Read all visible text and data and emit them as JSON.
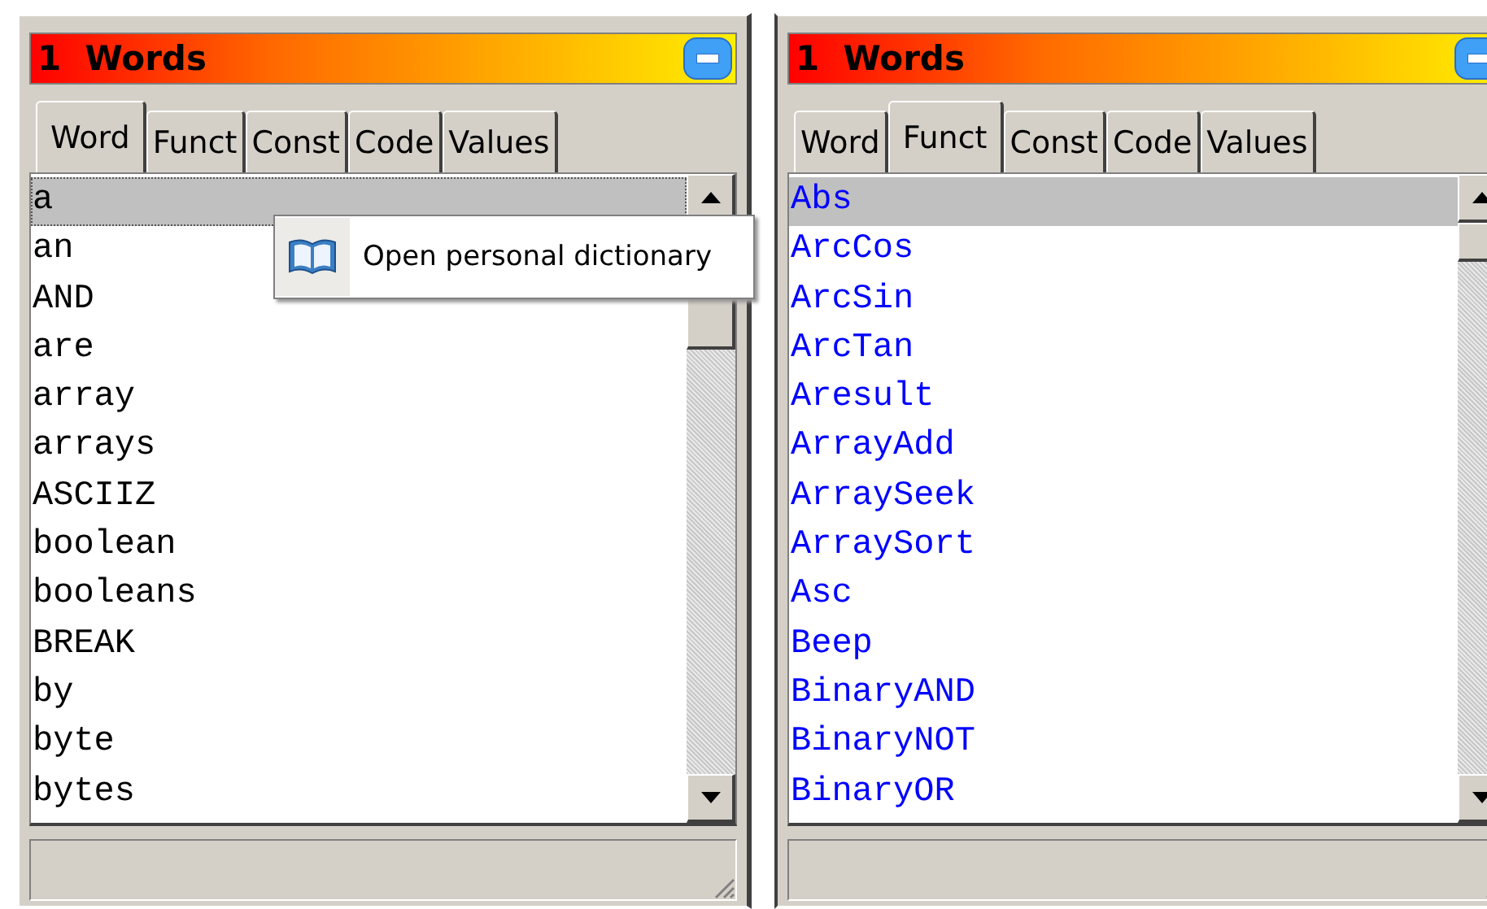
{
  "panels": [
    {
      "title": "1  Words",
      "kind": "word",
      "tabs": [
        {
          "label": "Word",
          "selected": true
        },
        {
          "label": "Funct",
          "selected": false
        },
        {
          "label": "Const",
          "selected": false
        },
        {
          "label": "Code",
          "selected": false
        },
        {
          "label": "Values",
          "selected": false
        }
      ],
      "items": [
        {
          "text": "a",
          "selected": true
        },
        {
          "text": "an",
          "selected": false
        },
        {
          "text": "AND",
          "selected": false
        },
        {
          "text": "are",
          "selected": false
        },
        {
          "text": "array",
          "selected": false
        },
        {
          "text": "arrays",
          "selected": false
        },
        {
          "text": "ASCIIZ",
          "selected": false
        },
        {
          "text": "boolean",
          "selected": false
        },
        {
          "text": "booleans",
          "selected": false
        },
        {
          "text": "BREAK",
          "selected": false
        },
        {
          "text": "by",
          "selected": false
        },
        {
          "text": "byte",
          "selected": false
        },
        {
          "text": "bytes",
          "selected": false
        }
      ]
    },
    {
      "title": "1  Words",
      "kind": "function",
      "tabs": [
        {
          "label": "Word",
          "selected": false
        },
        {
          "label": "Funct",
          "selected": true
        },
        {
          "label": "Const",
          "selected": false
        },
        {
          "label": "Code",
          "selected": false
        },
        {
          "label": "Values",
          "selected": false
        }
      ],
      "items": [
        {
          "text": "Abs",
          "selected": true
        },
        {
          "text": "ArcCos",
          "selected": false
        },
        {
          "text": "ArcSin",
          "selected": false
        },
        {
          "text": "ArcTan",
          "selected": false
        },
        {
          "text": "Aresult",
          "selected": false
        },
        {
          "text": "ArrayAdd",
          "selected": false
        },
        {
          "text": "ArraySeek",
          "selected": false
        },
        {
          "text": "ArraySort",
          "selected": false
        },
        {
          "text": "Asc",
          "selected": false
        },
        {
          "text": "Beep",
          "selected": false
        },
        {
          "text": "BinaryAND",
          "selected": false
        },
        {
          "text": "BinaryNOT",
          "selected": false
        },
        {
          "text": "BinaryOR",
          "selected": false
        }
      ]
    }
  ],
  "context_menu": {
    "items": [
      {
        "label": "Open personal dictionary"
      }
    ]
  }
}
